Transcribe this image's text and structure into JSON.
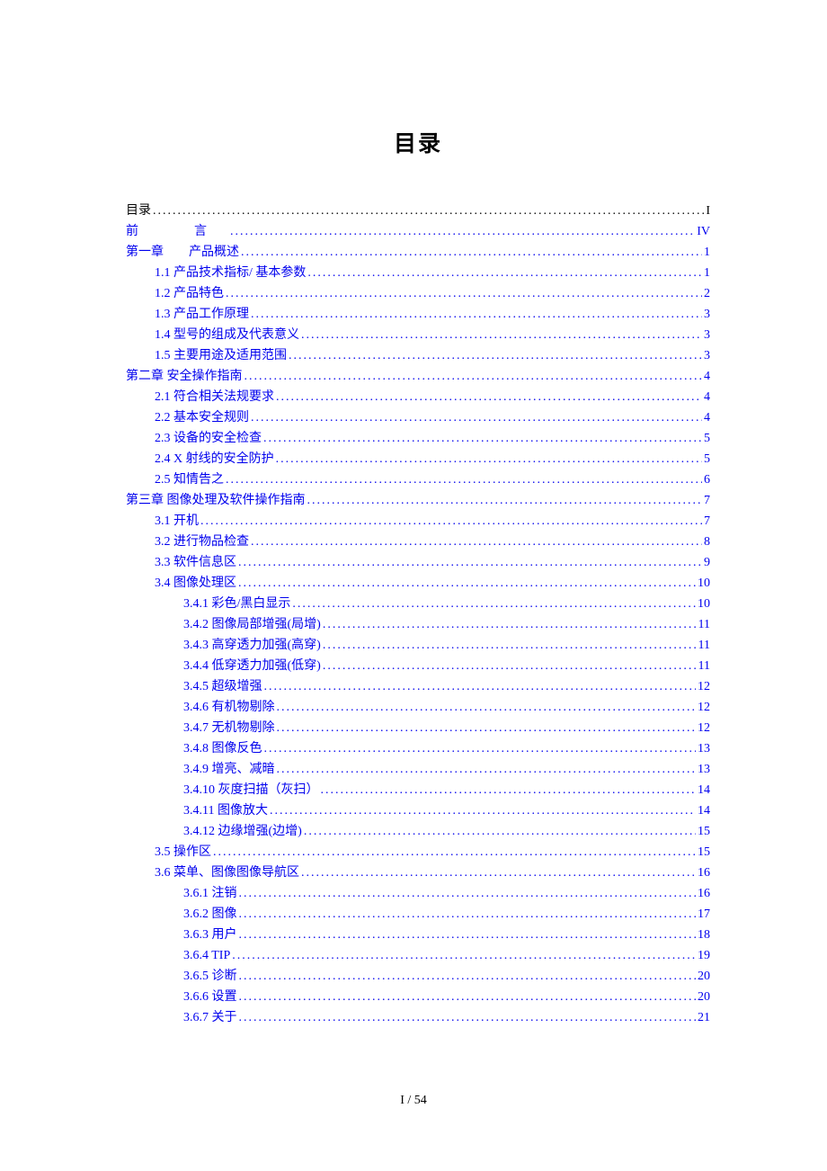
{
  "title": "目录",
  "footer": "I / 54",
  "toc": [
    {
      "label": "目录",
      "page": "I",
      "indent": 0,
      "link": false,
      "cls": ""
    },
    {
      "label": "前　言",
      "page": "IV",
      "indent": 0,
      "link": true,
      "cls": "preface-label"
    },
    {
      "label": "第一章　　产品概述",
      "page": "1",
      "indent": 0,
      "link": true,
      "cls": ""
    },
    {
      "label": "1.1  产品技术指标/  基本参数",
      "page": "1",
      "indent": 1,
      "link": true,
      "cls": ""
    },
    {
      "label": "1.2  产品特色",
      "page": "2",
      "indent": 1,
      "link": true,
      "cls": ""
    },
    {
      "label": "1.3  产品工作原理",
      "page": "3",
      "indent": 1,
      "link": true,
      "cls": ""
    },
    {
      "label": "1.4  型号的组成及代表意义",
      "page": "3",
      "indent": 1,
      "link": true,
      "cls": ""
    },
    {
      "label": "1.5  主要用途及适用范围",
      "page": "3",
      "indent": 1,
      "link": true,
      "cls": ""
    },
    {
      "label": "第二章  安全操作指南",
      "page": "4",
      "indent": 0,
      "link": true,
      "cls": ""
    },
    {
      "label": "2.1  符合相关法规要求",
      "page": "4",
      "indent": 1,
      "link": true,
      "cls": ""
    },
    {
      "label": "2.2  基本安全规则",
      "page": "4",
      "indent": 1,
      "link": true,
      "cls": ""
    },
    {
      "label": "2.3  设备的安全检查",
      "page": "5",
      "indent": 1,
      "link": true,
      "cls": ""
    },
    {
      "label": "2.4 X 射线的安全防护",
      "page": "5",
      "indent": 1,
      "link": true,
      "cls": ""
    },
    {
      "label": "2.5  知情告之",
      "page": "6",
      "indent": 1,
      "link": true,
      "cls": ""
    },
    {
      "label": "第三章  图像处理及软件操作指南",
      "page": "7",
      "indent": 0,
      "link": true,
      "cls": ""
    },
    {
      "label": "3.1  开机",
      "page": "7",
      "indent": 1,
      "link": true,
      "cls": ""
    },
    {
      "label": "3.2  进行物品检查",
      "page": "8",
      "indent": 1,
      "link": true,
      "cls": ""
    },
    {
      "label": "3.3  软件信息区",
      "page": "9",
      "indent": 1,
      "link": true,
      "cls": ""
    },
    {
      "label": "3.4  图像处理区",
      "page": "10",
      "indent": 1,
      "link": true,
      "cls": ""
    },
    {
      "label": "3.4.1  彩色/黑白显示",
      "page": "10",
      "indent": 2,
      "link": true,
      "cls": ""
    },
    {
      "label": "3.4.2  图像局部增强(局增)",
      "page": "11",
      "indent": 2,
      "link": true,
      "cls": ""
    },
    {
      "label": "3.4.3 高穿透力加强(高穿)",
      "page": "11",
      "indent": 2,
      "link": true,
      "cls": ""
    },
    {
      "label": "3.4.4  低穿透力加强(低穿)",
      "page": "11",
      "indent": 2,
      "link": true,
      "cls": ""
    },
    {
      "label": "3.4.5 超级增强",
      "page": "12",
      "indent": 2,
      "link": true,
      "cls": ""
    },
    {
      "label": "3.4.6  有机物剔除",
      "page": "12",
      "indent": 2,
      "link": true,
      "cls": ""
    },
    {
      "label": "3.4.7  无机物剔除",
      "page": "12",
      "indent": 2,
      "link": true,
      "cls": ""
    },
    {
      "label": "3.4.8  图像反色",
      "page": "13",
      "indent": 2,
      "link": true,
      "cls": ""
    },
    {
      "label": "3.4.9  增亮、减暗",
      "page": "13",
      "indent": 2,
      "link": true,
      "cls": ""
    },
    {
      "label": "3.4.10  灰度扫描（灰扫）",
      "page": "14",
      "indent": 2,
      "link": true,
      "cls": ""
    },
    {
      "label": "3.4.11 图像放大",
      "page": "14",
      "indent": 2,
      "link": true,
      "cls": ""
    },
    {
      "label": "3.4.12 边缘增强(边增)",
      "page": "15",
      "indent": 2,
      "link": true,
      "cls": ""
    },
    {
      "label": "3.5  操作区",
      "page": "15",
      "indent": 1,
      "link": true,
      "cls": ""
    },
    {
      "label": "3.6  菜单、图像图像导航区",
      "page": "16",
      "indent": 1,
      "link": true,
      "cls": ""
    },
    {
      "label": "3.6.1  注销",
      "page": "16",
      "indent": 2,
      "link": true,
      "cls": ""
    },
    {
      "label": "3.6.2  图像",
      "page": "17",
      "indent": 2,
      "link": true,
      "cls": ""
    },
    {
      "label": "3.6.3  用户",
      "page": "18",
      "indent": 2,
      "link": true,
      "cls": ""
    },
    {
      "label": "3.6.4 TIP",
      "page": "19",
      "indent": 2,
      "link": true,
      "cls": ""
    },
    {
      "label": "3.6.5  诊断",
      "page": "20",
      "indent": 2,
      "link": true,
      "cls": ""
    },
    {
      "label": "3.6.6  设置",
      "page": "20",
      "indent": 2,
      "link": true,
      "cls": ""
    },
    {
      "label": "3.6.7  关于",
      "page": "21",
      "indent": 2,
      "link": true,
      "cls": ""
    }
  ]
}
